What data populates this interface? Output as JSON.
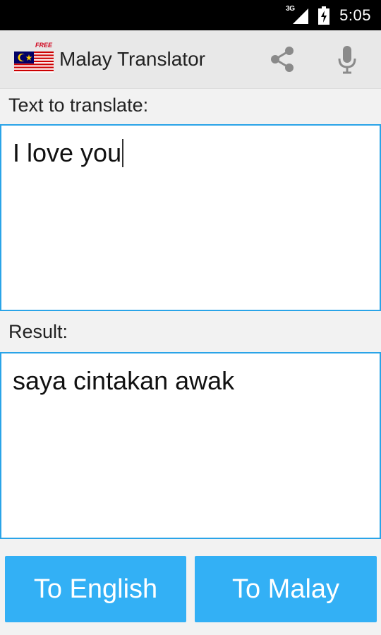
{
  "status_bar": {
    "network": "3G",
    "time": "5:05",
    "icons": [
      "signal-icon",
      "battery-charging-icon"
    ]
  },
  "action_bar": {
    "title": "Malay Translator",
    "free_tag": "FREE",
    "icons": [
      "malaysia-flag-icon",
      "share-icon",
      "microphone-icon"
    ]
  },
  "input_section": {
    "label": "Text to translate:",
    "value": "I love you"
  },
  "result_section": {
    "label": "Result:",
    "value": "saya cintakan awak"
  },
  "buttons": {
    "to_english": "To English",
    "to_malay": "To Malay"
  },
  "colors": {
    "accent": "#33b0f5",
    "border": "#2aa4e8",
    "action_bar": "#e8e8e8",
    "status_bar": "#000000"
  }
}
